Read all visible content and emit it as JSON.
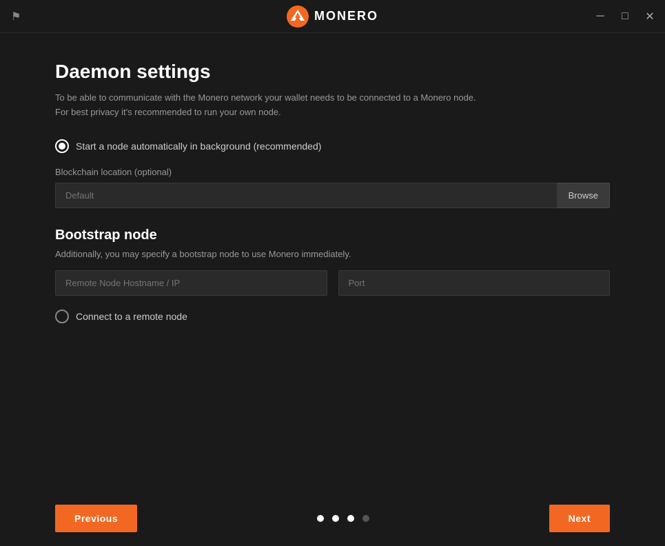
{
  "titlebar": {
    "app_name": "MONERO",
    "minimize_label": "─",
    "restore_label": "□",
    "close_label": "✕"
  },
  "page": {
    "title": "Daemon settings",
    "description_line1": "To be able to communicate with the Monero network your wallet needs to be connected to a Monero node.",
    "description_line2": "For best privacy it's recommended to run your own node.",
    "radio_option1_label": "Start a node automatically in background (recommended)",
    "radio_option1_checked": true,
    "blockchain_location_label": "Blockchain location (optional)",
    "blockchain_location_placeholder": "Default",
    "browse_button_label": "Browse",
    "bootstrap_section_title": "Bootstrap node",
    "bootstrap_section_desc": "Additionally, you may specify a bootstrap node to use Monero immediately.",
    "hostname_placeholder": "Remote Node Hostname / IP",
    "port_placeholder": "Port",
    "radio_option2_label": "Connect to a remote node",
    "radio_option2_checked": false,
    "previous_button_label": "Previous",
    "next_button_label": "Next",
    "pagination": {
      "dots": [
        {
          "active": true
        },
        {
          "active": true
        },
        {
          "active": true
        },
        {
          "active": false
        }
      ]
    }
  },
  "colors": {
    "accent": "#f26822",
    "background": "#1a1a1a",
    "input_bg": "#2a2a2a"
  }
}
